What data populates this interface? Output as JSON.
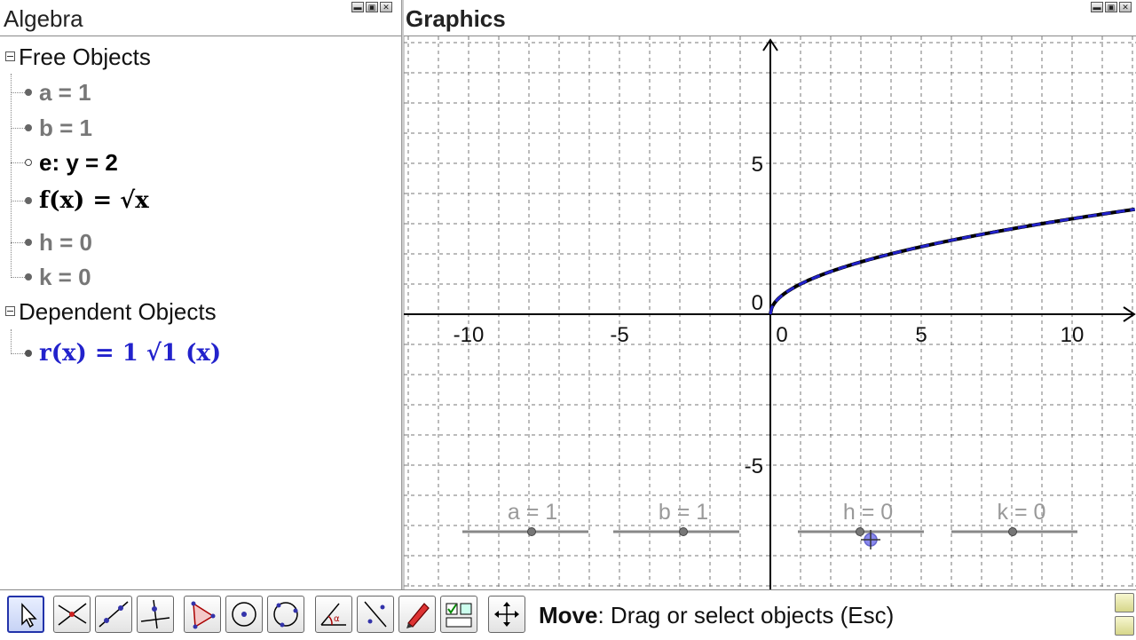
{
  "algebra": {
    "title": "Algebra",
    "free_label": "Free Objects",
    "dependent_label": "Dependent Objects",
    "free_items": [
      {
        "text": "a = 1",
        "color": "#777777",
        "marker": "filled"
      },
      {
        "text": "b = 1",
        "color": "#777777",
        "marker": "filled"
      },
      {
        "text": "e: y = 2",
        "color": "#000000",
        "marker": "hollow"
      },
      {
        "text": "f(x) = √x",
        "color": "#000000",
        "marker": "filled"
      },
      {
        "text": "h = 0",
        "color": "#777777",
        "marker": "filled"
      },
      {
        "text": "k = 0",
        "color": "#777777",
        "marker": "filled"
      }
    ],
    "dependent_items": [
      {
        "text": "r(x) = 1 √1 (x)",
        "color": "#2222cc",
        "marker": "filled"
      }
    ]
  },
  "graphics": {
    "title": "Graphics",
    "x_ticks": [
      "-10",
      "-5",
      "0",
      "5",
      "10"
    ],
    "y_ticks": [
      "5",
      "0",
      "-5"
    ],
    "sliders": [
      {
        "label": "a = 1",
        "value": 1,
        "min": -5,
        "max": 5
      },
      {
        "label": "b = 1",
        "value": 1,
        "min": -5,
        "max": 5
      },
      {
        "label": "h = 0",
        "value": 0,
        "min": -5,
        "max": 5
      },
      {
        "label": "k = 0",
        "value": 0,
        "min": -5,
        "max": 5
      }
    ],
    "curve_color": "#2222cc"
  },
  "toolbar": {
    "tools": [
      "move-tool",
      "point-tool",
      "line-tool",
      "perpendicular-tool",
      "polygon-tool",
      "circle-tool",
      "conic-tool",
      "angle-tool",
      "reflect-tool",
      "text-tool",
      "checkbox-tool",
      "move-view-tool"
    ],
    "help_bold": "Move",
    "help_text": ": Drag or select objects (Esc)"
  }
}
